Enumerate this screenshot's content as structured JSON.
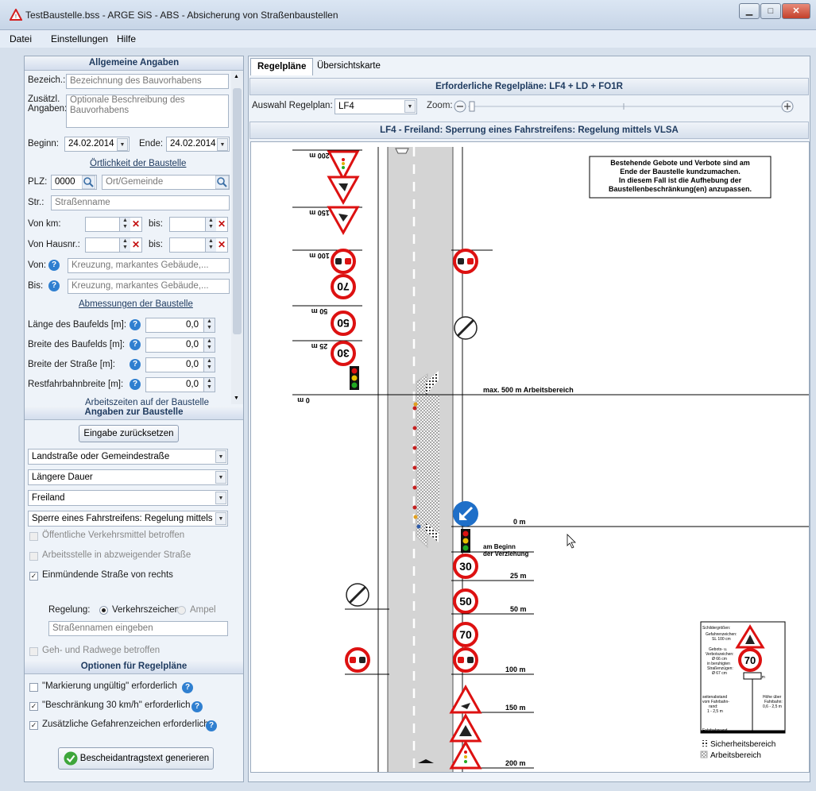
{
  "window": {
    "title": "TestBaustelle.bss - ARGE SiS - ABS - Absicherung von Straßenbaustellen"
  },
  "menu": [
    "Datei",
    "Einstellungen",
    "Hilfe"
  ],
  "general": {
    "title": "Allgemeine Angaben",
    "bez_label": "Bezeich.:",
    "bez_placeholder": "Bezeichnung des Bauvorhabens",
    "zus_label": "Zusätzl. Angaben:",
    "zus_placeholder": "Optionale Beschreibung des Bauvorhabens",
    "begin_label": "Beginn:",
    "begin_value": "24.02.2014",
    "end_label": "Ende:",
    "end_value": "24.02.2014",
    "loc_title": "Örtlichkeit der Baustelle",
    "plz_label": "PLZ:",
    "plz_value": "0000",
    "ort_placeholder": "Ort/Gemeinde",
    "str_label": "Str.:",
    "str_placeholder": "Straßenname",
    "vonkm_label": "Von km:",
    "bis_label": "bis:",
    "vonhaus_label": "Von Hausnr.:",
    "von_label": "Von:",
    "bis2_label": "Bis:",
    "kreuz_placeholder": "Kreuzung, markantes Gebäude,...",
    "dim_title": "Abmessungen der Baustelle",
    "dims": [
      {
        "label": "Länge des Baufelds [m]:",
        "value": "0,0"
      },
      {
        "label": "Breite des Baufelds [m]:",
        "value": "0,0"
      },
      {
        "label": "Breite der Straße [m]:",
        "value": "0,0"
      },
      {
        "label": "Restfahrbahnbreite [m]:",
        "value": "0,0"
      }
    ],
    "work_title": "Arbeitszeiten auf der Baustelle"
  },
  "site": {
    "title": "Angaben zur Baustelle",
    "reset": "Eingabe zurücksetzen",
    "selects": [
      "Landstraße oder Gemeindestraße",
      "Längere Dauer",
      "Freiland",
      "Sperre eines Fahrstreifens: Regelung mittels V"
    ],
    "checks": [
      {
        "label": "Öffentliche Verkehrsmittel betroffen",
        "checked": false,
        "disabled": true
      },
      {
        "label": "Arbeitsstelle in abzweigender Straße",
        "checked": false,
        "disabled": true
      },
      {
        "label": "Einmündende Straße von rechts",
        "checked": true,
        "disabled": false
      }
    ],
    "regelung_label": "Regelung:",
    "radio1": "Verkehrszeichen",
    "radio2": "Ampel",
    "strname_placeholder": "Straßennamen eingeben",
    "geh": "Geh- und Radwege betroffen"
  },
  "options": {
    "title": "Optionen für Regelpläne",
    "items": [
      {
        "label": "\"Markierung ungültig\" erforderlich",
        "checked": false
      },
      {
        "label": "\"Beschränkung 30 km/h\" erforderlich",
        "checked": true
      },
      {
        "label": "Zusätzliche Gefahrenzeichen erforderlich",
        "checked": true
      }
    ],
    "generate": "Bescheidantragstext generieren"
  },
  "tabs": [
    "Regelpläne",
    "Übersichtskarte"
  ],
  "plans": {
    "required": "Erforderliche Regelpläne: LF4 + LD + FO1R",
    "select_label": "Auswahl Regelplan:",
    "select_value": "LF4",
    "zoom_label": "Zoom:",
    "plan_title": "LF4 - Freiland: Sperrung eines Fahrstreifens: Regelung mittels VLSA"
  },
  "diagram": {
    "note": [
      "Bestehende Gebote und Verbote sind am",
      "Ende der Baustelle kundzumachen.",
      "In diesem Fall ist die Aufhebung der",
      "Baustellenbeschränkung(en) anzupassen."
    ],
    "top_marks": [
      "200 m",
      "150 m",
      "100 m",
      "50 m",
      "25 m",
      "0 m"
    ],
    "work_area": "max. 500 m Arbeitsbereich",
    "bottom_zero": "0 m",
    "begin_text": [
      "am Beginn",
      "der Verziehung"
    ],
    "bottom_marks": [
      "25 m",
      "50 m",
      "100 m",
      "150 m",
      "200 m"
    ],
    "speeds_top": [
      "70",
      "50",
      "30"
    ],
    "speeds_bottom": [
      "30",
      "50",
      "70"
    ],
    "legend_sizes": [
      "Schildergrößen:",
      "Gefahrenzeichen:",
      "SL 100 cm",
      "Gebots- u.",
      "Verbotszeichen:",
      "Ø 66 cm",
      "in beruhigten",
      "Straßenzügen:",
      "Ø 67 cm"
    ],
    "legend_dims": [
      "3 km",
      "seitenabstand",
      "vom Fahrbahn-",
      "rand:",
      "1 - 2,5 m",
      "Höhe über",
      "Fahrbahn:",
      "0,6 - 2,5 m",
      "Fahrbahnrand"
    ],
    "legend_70": "70",
    "legend_sb": "Sicherheitsbereich",
    "legend_ab": "Arbeitsbereich"
  }
}
